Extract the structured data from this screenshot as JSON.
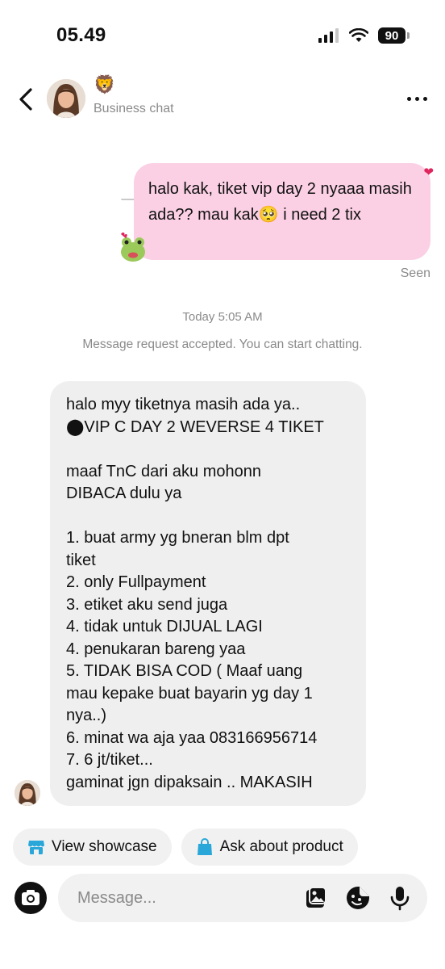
{
  "status_bar": {
    "time": "05.49",
    "battery": "90"
  },
  "header": {
    "emoji": "🦁",
    "subtitle": "Business chat"
  },
  "outgoing_message": {
    "text": "halo kak, tiket vip day 2 nyaaa masih ada?? mau kak🥺 i need 2 tix",
    "status": "Seen"
  },
  "timestamp": "Today 5:05 AM",
  "notice": "Message request accepted. You can start chatting.",
  "incoming_message": {
    "text": "halo myy tiketnya masih ada ya..\n⬤VIP C DAY 2 WEVERSE 4 TIKET\n\nmaaf TnC dari aku mohonn\nDIBACA dulu ya\n\n1. buat army yg bneran blm dpt\ntiket\n2. only Fullpayment\n3. etiket aku send juga\n4. tidak untuk DIJUAL LAGI\n4. penukaran bareng yaa\n5. TIDAK BISA COD ( Maaf uang\nmau kepake buat bayarin yg day 1\nnya..)\n6. minat wa aja yaa 083166956714\n7. 6 jt/tiket...\ngaminat jgn dipaksain .. MAKASIH"
  },
  "chips": {
    "showcase": "View showcase",
    "ask": "Ask about product"
  },
  "composer": {
    "placeholder": "Message..."
  },
  "colors": {
    "outgoing_bubble": "#fbd0e4",
    "incoming_bubble": "#efefef",
    "chip_icon": "#2aa7d9",
    "heart": "#e0245e"
  }
}
